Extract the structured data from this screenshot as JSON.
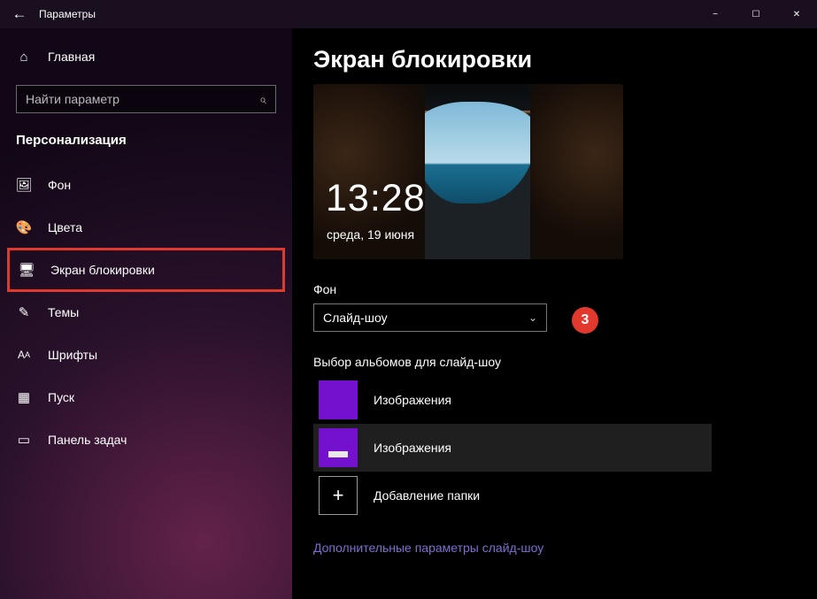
{
  "title_bar": {
    "app_title": "Параметры"
  },
  "win": {
    "min": "−",
    "max": "☐",
    "close": "✕"
  },
  "sidebar": {
    "home": "Главная",
    "search_placeholder": "Найти параметр",
    "section": "Персонализация",
    "items": [
      {
        "icon": "🖼",
        "label": "Фон"
      },
      {
        "icon": "🎨",
        "label": "Цвета"
      },
      {
        "icon": "🖥",
        "label": "Экран блокировки"
      },
      {
        "icon": "✎",
        "label": "Темы"
      },
      {
        "icon": "A",
        "label": "Шрифты"
      },
      {
        "icon": "▦",
        "label": "Пуск"
      },
      {
        "icon": "▭",
        "label": "Панель задач"
      }
    ]
  },
  "main": {
    "page_title": "Экран блокировки",
    "preview_time": "13:28",
    "preview_date": "среда, 19 июня",
    "bg_label": "Фон",
    "bg_value": "Слайд-шоу",
    "marker": "3",
    "albums_label": "Выбор альбомов для слайд-шоу",
    "album1": "Изображения",
    "album2": "Изображения",
    "add_folder": "Добавление папки",
    "more_link": "Дополнительные параметры слайд-шоу"
  }
}
